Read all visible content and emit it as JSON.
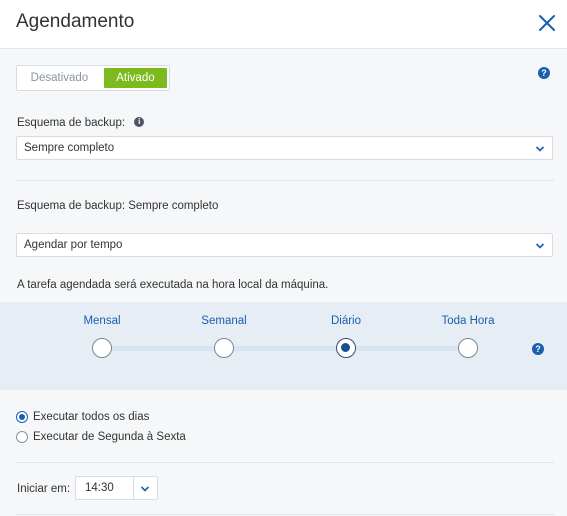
{
  "header": {
    "title": "Agendamento"
  },
  "toggle": {
    "off_label": "Desativado",
    "on_label": "Ativado"
  },
  "backup_scheme": {
    "label": "Esquema de backup:",
    "selected": "Sempre completo",
    "summary": "Esquema de backup: Sempre completo"
  },
  "schedule_type": {
    "selected": "Agendar por tempo"
  },
  "note": "A tarefa agendada será executada na hora local da máquina.",
  "frequency": {
    "options": [
      "Mensal",
      "Semanal",
      "Diário",
      "Toda Hora"
    ],
    "selected": "Diário"
  },
  "run_options": [
    {
      "label": "Executar todos os dias",
      "checked": true
    },
    {
      "label": "Executar de Segunda à Sexta",
      "checked": false
    }
  ],
  "start": {
    "label": "Iniciar em:",
    "time": "14:30"
  },
  "colors": {
    "accent": "#1a5eb0",
    "active_toggle": "#7cba1d"
  },
  "icons": {
    "close": "close-icon",
    "help": "help-icon",
    "info": "info-icon",
    "dropdown": "chevron-down-icon"
  }
}
